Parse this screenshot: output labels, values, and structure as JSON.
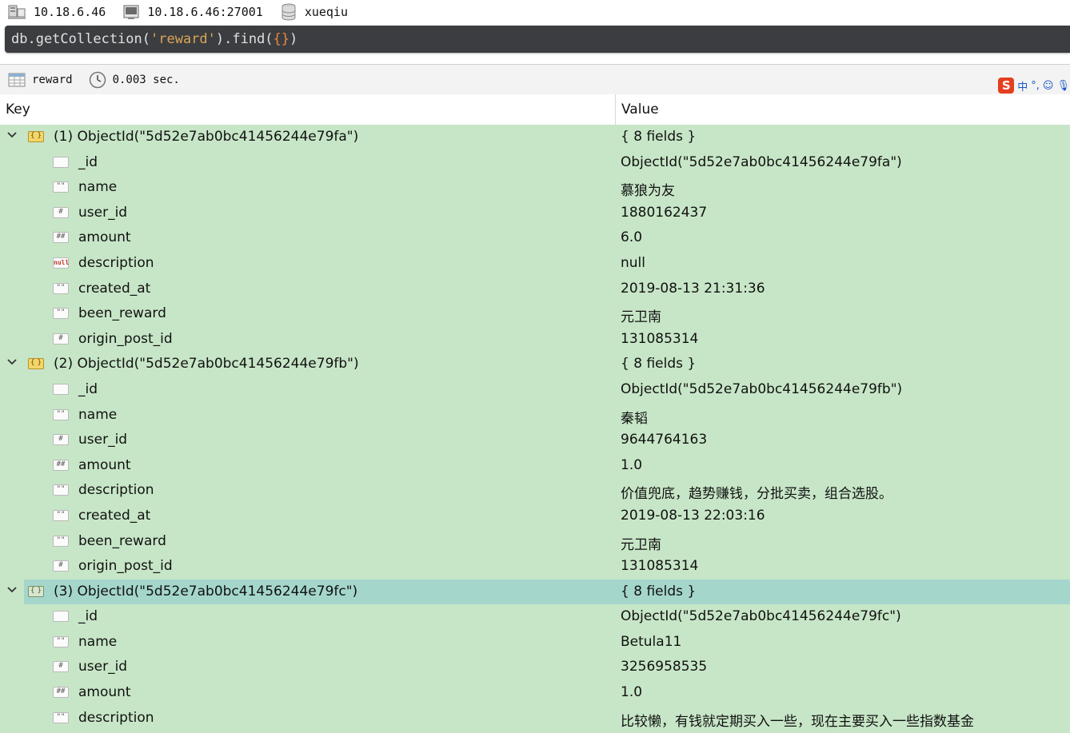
{
  "connection": {
    "host": "10.18.6.46",
    "server": "10.18.6.46:27001",
    "database": "xueqiu"
  },
  "query": {
    "prefix": "db.getCollection(",
    "collection": "'reward'",
    "middle": ").find(",
    "arg": "{}",
    "suffix": ")"
  },
  "status": {
    "collection": "reward",
    "time": "0.003 sec."
  },
  "ime": {
    "label": "中",
    "dots": "°,",
    "smile": "☺",
    "mic": "🎙"
  },
  "columns": {
    "key": "Key",
    "value": "Value"
  },
  "rows": [
    {
      "level": "top",
      "key": "(1) ObjectId(\"5d52e7ab0bc41456244e79fa\")",
      "value": "{ 8 fields }",
      "icon": "object"
    },
    {
      "level": "child",
      "key": "_id",
      "value": "ObjectId(\"5d52e7ab0bc41456244e79fa\")",
      "icon": "id"
    },
    {
      "level": "child",
      "key": "name",
      "value": "慕狼为友",
      "icon": "string"
    },
    {
      "level": "child",
      "key": "user_id",
      "value": "1880162437",
      "icon": "int"
    },
    {
      "level": "child",
      "key": "amount",
      "value": "6.0",
      "icon": "double"
    },
    {
      "level": "child",
      "key": "description",
      "value": "null",
      "icon": "null"
    },
    {
      "level": "child",
      "key": "created_at",
      "value": "2019-08-13 21:31:36",
      "icon": "string"
    },
    {
      "level": "child",
      "key": "been_reward",
      "value": "元卫南",
      "icon": "string"
    },
    {
      "level": "child",
      "key": "origin_post_id",
      "value": "131085314",
      "icon": "int"
    },
    {
      "level": "top",
      "key": "(2) ObjectId(\"5d52e7ab0bc41456244e79fb\")",
      "value": "{ 8 fields }",
      "icon": "object"
    },
    {
      "level": "child",
      "key": "_id",
      "value": "ObjectId(\"5d52e7ab0bc41456244e79fb\")",
      "icon": "id"
    },
    {
      "level": "child",
      "key": "name",
      "value": "秦韬",
      "icon": "string"
    },
    {
      "level": "child",
      "key": "user_id",
      "value": "9644764163",
      "icon": "int"
    },
    {
      "level": "child",
      "key": "amount",
      "value": "1.0",
      "icon": "double"
    },
    {
      "level": "child",
      "key": "description",
      "value": "价值兜底，趋势赚钱，分批买卖，组合选股。",
      "icon": "string"
    },
    {
      "level": "child",
      "key": "created_at",
      "value": "2019-08-13 22:03:16",
      "icon": "string"
    },
    {
      "level": "child",
      "key": "been_reward",
      "value": "元卫南",
      "icon": "string"
    },
    {
      "level": "child",
      "key": "origin_post_id",
      "value": "131085314",
      "icon": "int"
    },
    {
      "level": "top",
      "key": "(3) ObjectId(\"5d52e7ab0bc41456244e79fc\")",
      "value": "{ 8 fields }",
      "icon": "object",
      "selected": true
    },
    {
      "level": "child",
      "key": "_id",
      "value": "ObjectId(\"5d52e7ab0bc41456244e79fc\")",
      "icon": "id"
    },
    {
      "level": "child",
      "key": "name",
      "value": "Betula11",
      "icon": "string"
    },
    {
      "level": "child",
      "key": "user_id",
      "value": "3256958535",
      "icon": "int"
    },
    {
      "level": "child",
      "key": "amount",
      "value": "1.0",
      "icon": "double"
    },
    {
      "level": "child",
      "key": "description",
      "value": "比较懒，有钱就定期买入一些，现在主要买入一些指数基金",
      "icon": "string"
    }
  ],
  "icons": {
    "int": "#",
    "double": "##",
    "string": "\"\"",
    "null": "null",
    "object": "{ }"
  }
}
